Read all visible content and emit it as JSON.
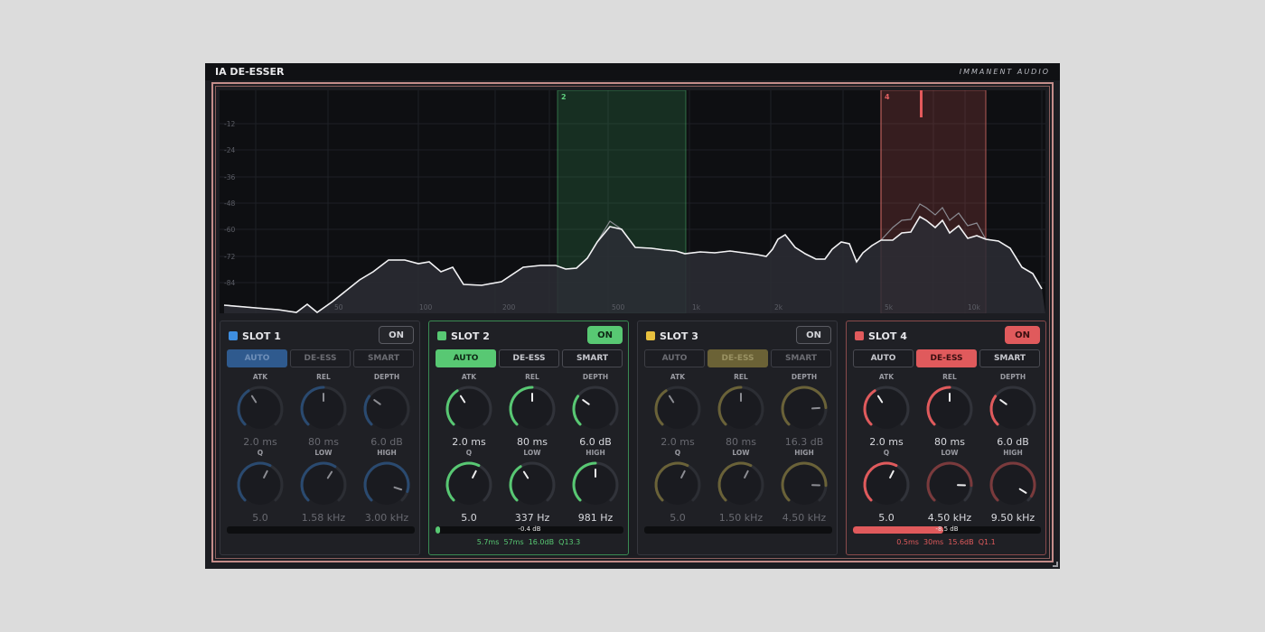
{
  "app": {
    "title": "IA DE-ESSER",
    "brand": "IMMANENT AUDIO"
  },
  "colors": {
    "slot1": "#3e8ee0",
    "slot2": "#58c873",
    "slot3": "#e8c03e",
    "slot4": "#e05a5c",
    "frame": "#c48d8a"
  },
  "spectrum": {
    "db_labels": [
      "-12",
      "-24",
      "-36",
      "-48",
      "-60",
      "-72",
      "-84"
    ],
    "hz_labels": [
      "50",
      "100",
      "200",
      "500",
      "1k",
      "2k",
      "5k",
      "10k"
    ],
    "bands": [
      {
        "label": "2"
      },
      {
        "label": "4"
      }
    ]
  },
  "slots": [
    {
      "title": "SLOT 1",
      "on_label": "ON",
      "on_active": false,
      "dimmed": true,
      "modes": [
        {
          "label": "AUTO",
          "active": true
        },
        {
          "label": "DE-ESS",
          "active": false
        },
        {
          "label": "SMART",
          "active": false
        }
      ],
      "knob_labels": [
        "ATK",
        "REL",
        "DEPTH",
        "Q",
        "LOW",
        "HIGH"
      ],
      "values": [
        "2.0 ms",
        "80 ms",
        "6.0 dB",
        "5.0",
        "1.58 kHz",
        "3.00 kHz"
      ],
      "levels": [
        0.38,
        0.5,
        0.3,
        0.6,
        0.62,
        0.9
      ],
      "meter_level": 0,
      "meter_text": "",
      "stats": ""
    },
    {
      "title": "SLOT 2",
      "on_label": "ON",
      "on_active": true,
      "dimmed": false,
      "modes": [
        {
          "label": "AUTO",
          "active": true
        },
        {
          "label": "DE-ESS",
          "active": false
        },
        {
          "label": "SMART",
          "active": false
        }
      ],
      "knob_labels": [
        "ATK",
        "REL",
        "DEPTH",
        "Q",
        "LOW",
        "HIGH"
      ],
      "values": [
        "2.0 ms",
        "80 ms",
        "6.0 dB",
        "5.0",
        "337 Hz",
        "981 Hz"
      ],
      "levels": [
        0.38,
        0.5,
        0.3,
        0.6,
        0.38,
        0.5
      ],
      "meter_level": 0.02,
      "meter_text": "-0.4 dB",
      "stats": "5.7ms  57ms  16.0dB  Q13.3"
    },
    {
      "title": "SLOT 3",
      "on_label": "ON",
      "on_active": false,
      "dimmed": true,
      "modes": [
        {
          "label": "AUTO",
          "active": false
        },
        {
          "label": "DE-ESS",
          "active": true
        },
        {
          "label": "SMART",
          "active": false
        }
      ],
      "knob_labels": [
        "ATK",
        "REL",
        "DEPTH",
        "Q",
        "LOW",
        "HIGH"
      ],
      "values": [
        "2.0 ms",
        "80 ms",
        "16.3 dB",
        "5.0",
        "1.50 kHz",
        "4.50 kHz"
      ],
      "levels": [
        0.38,
        0.5,
        0.82,
        0.6,
        0.6,
        0.84
      ],
      "meter_level": 0,
      "meter_text": "",
      "stats": ""
    },
    {
      "title": "SLOT 4",
      "on_label": "ON",
      "on_active": true,
      "dimmed": false,
      "modes": [
        {
          "label": "AUTO",
          "active": false
        },
        {
          "label": "DE-ESS",
          "active": true
        },
        {
          "label": "SMART",
          "active": false
        }
      ],
      "knob_labels": [
        "ATK",
        "REL",
        "DEPTH",
        "Q",
        "LOW",
        "HIGH"
      ],
      "values": [
        "2.0 ms",
        "80 ms",
        "6.0 dB",
        "5.0",
        "4.50 kHz",
        "9.50 kHz"
      ],
      "levels": [
        0.38,
        0.5,
        0.3,
        0.6,
        0.84,
        0.95
      ],
      "meter_level": 0.48,
      "meter_text": "-8.5 dB",
      "stats": "0.5ms  30ms  15.6dB  Q1.1"
    }
  ]
}
